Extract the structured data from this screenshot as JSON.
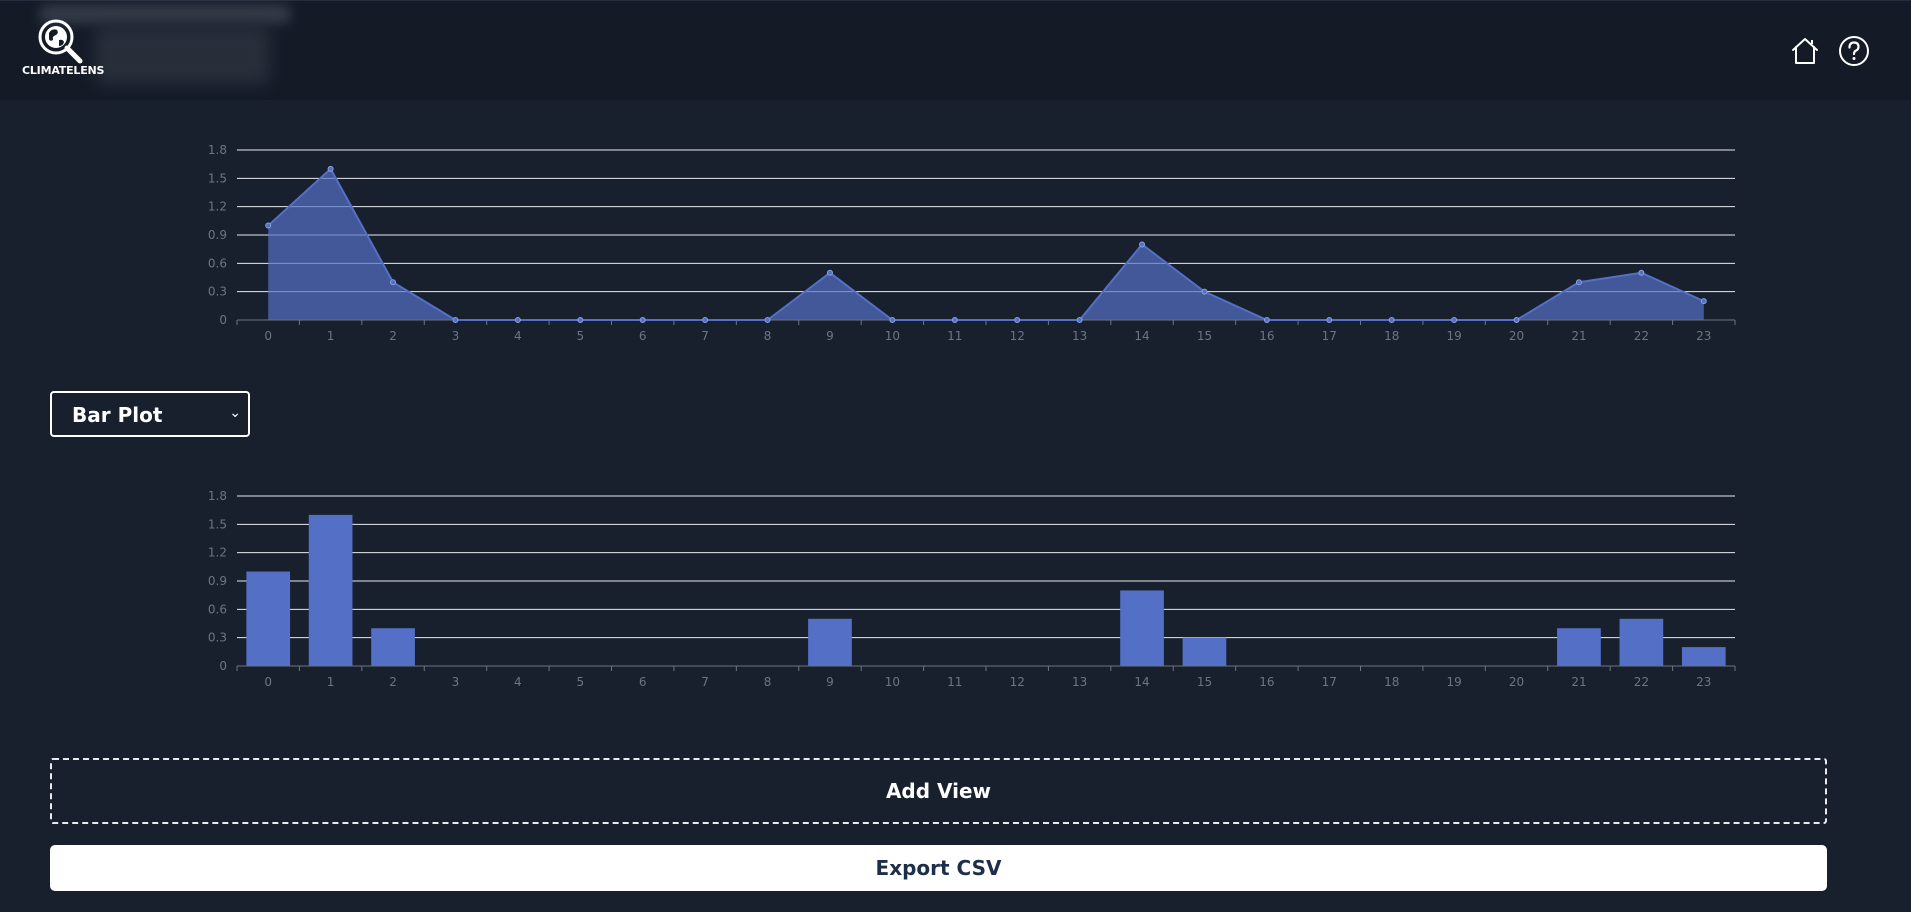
{
  "app": {
    "logo_text": "CLIMATELENS"
  },
  "header": {
    "home_icon": "home-icon",
    "help_icon": "help-icon"
  },
  "colors": {
    "background": "#18202d",
    "header": "#141b27",
    "series": "#5470c6",
    "grid": "#e6e9ef",
    "axis_text": "#6c7584"
  },
  "view_selector": {
    "selected": "Bar Plot"
  },
  "buttons": {
    "add_view": "Add View",
    "export_csv": "Export CSV"
  },
  "chart_data": [
    {
      "type": "area",
      "x": [
        "0",
        "1",
        "2",
        "3",
        "4",
        "5",
        "6",
        "7",
        "8",
        "9",
        "10",
        "11",
        "12",
        "13",
        "14",
        "15",
        "16",
        "17",
        "18",
        "19",
        "20",
        "21",
        "22",
        "23"
      ],
      "values": [
        1.0,
        1.6,
        0.4,
        0,
        0,
        0,
        0,
        0,
        0,
        0.5,
        0,
        0,
        0,
        0,
        0.8,
        0.3,
        0,
        0,
        0,
        0,
        0,
        0.4,
        0.5,
        0.2
      ],
      "yticks": [
        "0",
        "0.3",
        "0.6",
        "0.9",
        "1.2",
        "1.5",
        "1.8"
      ],
      "ylim": [
        0,
        1.8
      ],
      "grid": true
    },
    {
      "type": "bar",
      "categories": [
        "0",
        "1",
        "2",
        "3",
        "4",
        "5",
        "6",
        "7",
        "8",
        "9",
        "10",
        "11",
        "12",
        "13",
        "14",
        "15",
        "16",
        "17",
        "18",
        "19",
        "20",
        "21",
        "22",
        "23"
      ],
      "values": [
        1.0,
        1.6,
        0.4,
        0,
        0,
        0,
        0,
        0,
        0,
        0.5,
        0,
        0,
        0,
        0,
        0.8,
        0.3,
        0,
        0,
        0,
        0,
        0,
        0.4,
        0.5,
        0.2
      ],
      "yticks": [
        "0",
        "0.3",
        "0.6",
        "0.9",
        "1.2",
        "1.5",
        "1.8"
      ],
      "ylim": [
        0,
        1.8
      ],
      "grid": true
    }
  ]
}
